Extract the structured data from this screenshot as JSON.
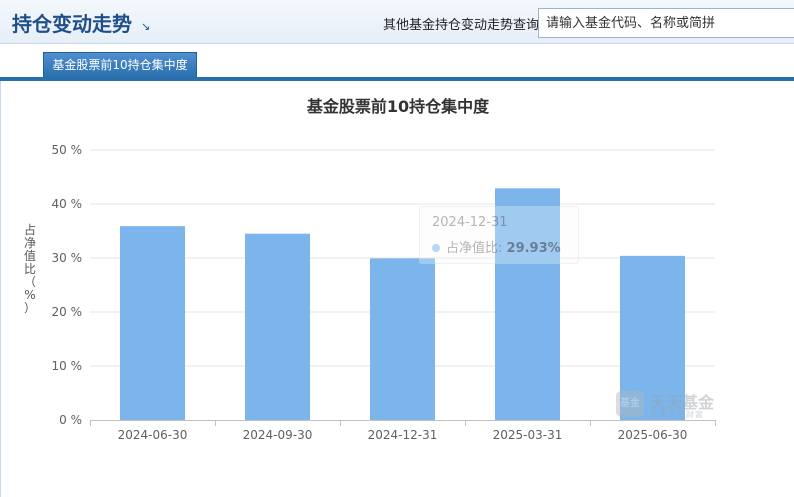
{
  "header": {
    "title": "持仓变动走势",
    "arrow_glyph": "↘",
    "query_label": "其他基金持仓变动走势查询:",
    "query_placeholder": "请输入基金代码、名称或简拼"
  },
  "tabs": [
    {
      "label": "基金股票前10持仓集中度",
      "active": true
    }
  ],
  "tooltip": {
    "date": "2024-12-31",
    "series_label": "占净值比:",
    "value": "29.93%"
  },
  "watermark": {
    "logo_text": "基金",
    "brand": "天天基金",
    "tagline": "投资开启财富"
  },
  "colors": {
    "bar": "#7cb5ec",
    "accent": "#2a6fad",
    "title_blue": "#1f4f8a"
  },
  "chart_data": {
    "type": "bar",
    "title": "基金股票前10持仓集中度",
    "ylabel": "占净值比（%）",
    "xlabel": "",
    "categories": [
      "2024-06-30",
      "2024-09-30",
      "2024-12-31",
      "2025-03-31",
      "2025-06-30"
    ],
    "values": [
      35.9,
      34.5,
      29.93,
      42.9,
      30.4
    ],
    "ylim": [
      0,
      50
    ],
    "yticks": [
      0,
      10,
      20,
      30,
      40,
      50
    ],
    "ytick_labels": [
      "0 %",
      "10 %",
      "20 %",
      "30 %",
      "40 %",
      "50 %"
    ],
    "grid": true,
    "legend": "none"
  }
}
